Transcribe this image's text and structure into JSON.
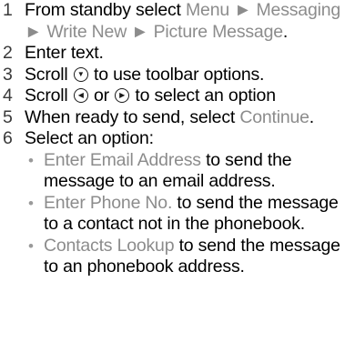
{
  "steps": [
    {
      "num": "1",
      "text_before": "From standby select ",
      "path": "Menu ► Messaging ► Write New ► Picture Message",
      "text_after": "."
    },
    {
      "num": "2",
      "text": "Enter text."
    },
    {
      "num": "3",
      "text_before": "Scroll ",
      "icon": "nav-down-icon",
      "text_after": " to use toolbar options."
    },
    {
      "num": "4",
      "text_before": "Scroll ",
      "icon_a": "nav-left-icon",
      "text_mid": " or ",
      "icon_b": "nav-right-icon",
      "text_after": " to select an option"
    },
    {
      "num": "5",
      "text_before": "When ready to send, select ",
      "highlight": "Continue",
      "text_after": "."
    },
    {
      "num": "6",
      "text": "Select an option:",
      "options": [
        {
          "bullet": "•",
          "label": "Enter Email Address",
          "desc": " to send the message to an email address."
        },
        {
          "bullet": "•",
          "label": "Enter Phone No.",
          "desc": " to send the message to a contact not in the phonebook."
        },
        {
          "bullet": "•",
          "label": "Contacts Lookup",
          "desc": " to send the message to an phonebook address."
        }
      ]
    }
  ],
  "colors": {
    "highlight": "#8c8c8c",
    "text": "#000000",
    "bullet": "#9a9a9a"
  }
}
